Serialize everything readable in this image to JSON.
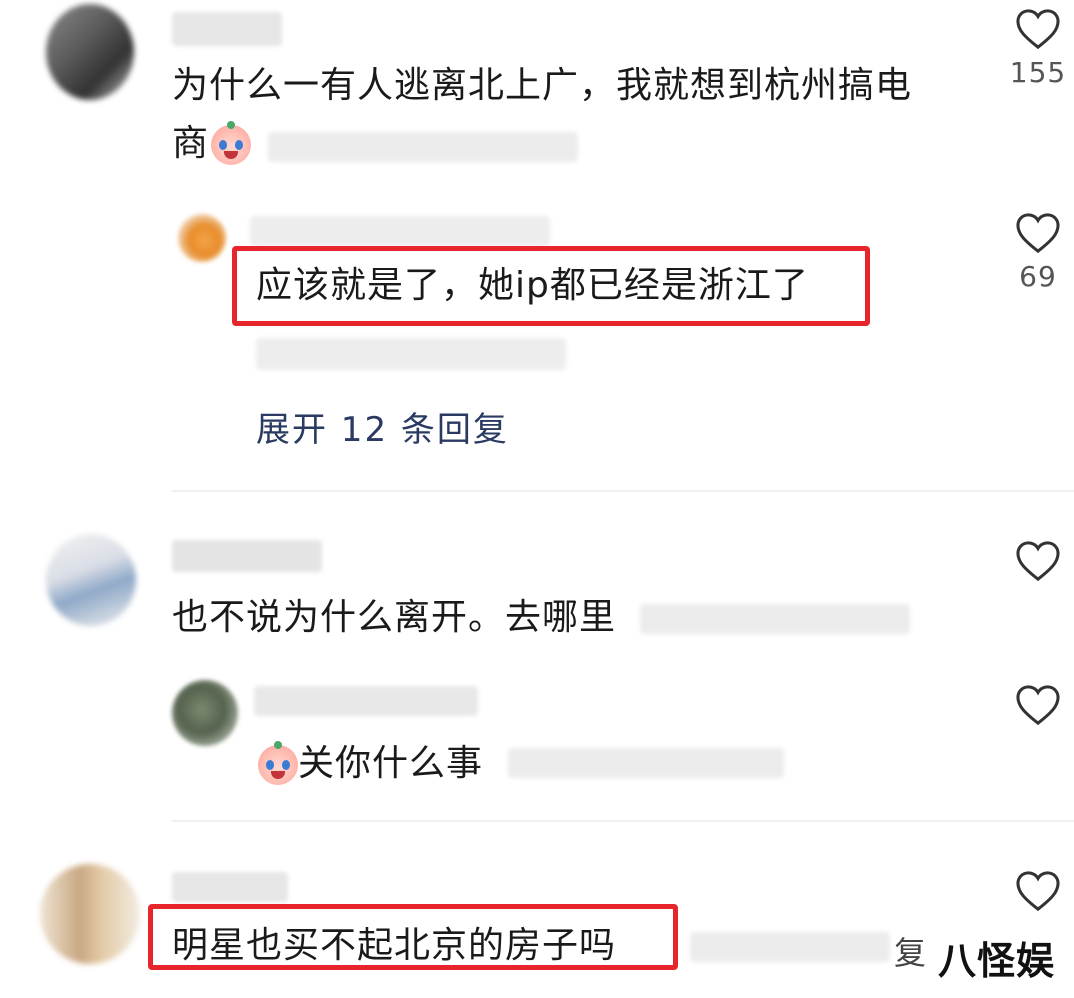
{
  "comments": [
    {
      "text": "为什么一有人逃离北上广，我就想到杭州搞电",
      "text_line2": "商",
      "likes": "155",
      "reply": {
        "text": "应该就是了，她ip都已经是浙江了",
        "likes": "69"
      },
      "expand_label": "展开 12 条回复"
    },
    {
      "text": "也不说为什么离开。去哪里",
      "reply": {
        "text": "关你什么事",
        "likes": ""
      }
    },
    {
      "text": "明星也买不起北京的房子吗",
      "meta_tail": "复"
    }
  ],
  "watermark": "八怪娱",
  "colors": {
    "highlight": "#e8252b",
    "expand_link": "#2a3a62",
    "like_count": "#555555"
  },
  "icons": {
    "like": "heart-outline-icon",
    "emoji": "crying-face-emoji"
  }
}
